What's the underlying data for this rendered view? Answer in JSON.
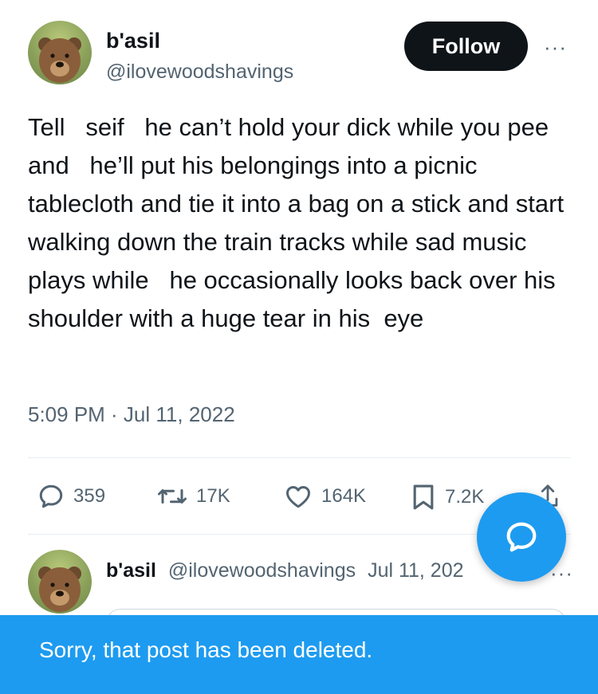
{
  "tweet": {
    "author_name": "b'asil",
    "author_handle": "@ilovewoodshavings",
    "follow_label": "Follow",
    "more_label": "···",
    "text": "Tell   seif   he can’t hold your dick while you pee and   he’ll put his belongings into a picnic tablecloth and tie it into a bag on a stick and start walking down the train tracks while sad music plays while   he occasionally looks back over his  shoulder with a huge tear in his  eye",
    "timestamp": "5:09 PM · Jul 11, 2022"
  },
  "actions": {
    "reply_count": "359",
    "retweet_count": "17K",
    "like_count": "164K",
    "bookmark_count": "7.2K"
  },
  "reply": {
    "author_name": "b'asil",
    "author_handle": "@ilovewoodshavings",
    "date": "Jul 11, 202",
    "more_label": "···"
  },
  "banner": {
    "message": "Sorry, that post has been deleted."
  },
  "icons": {
    "reply": "reply-icon",
    "retweet": "retweet-icon",
    "like": "heart-icon",
    "bookmark": "bookmark-icon",
    "share": "share-icon",
    "compose": "compose-reply-icon"
  },
  "colors": {
    "accent": "#1d9bf0",
    "text": "#0f1419",
    "muted": "#536471",
    "follow_bg": "#0f1419"
  }
}
